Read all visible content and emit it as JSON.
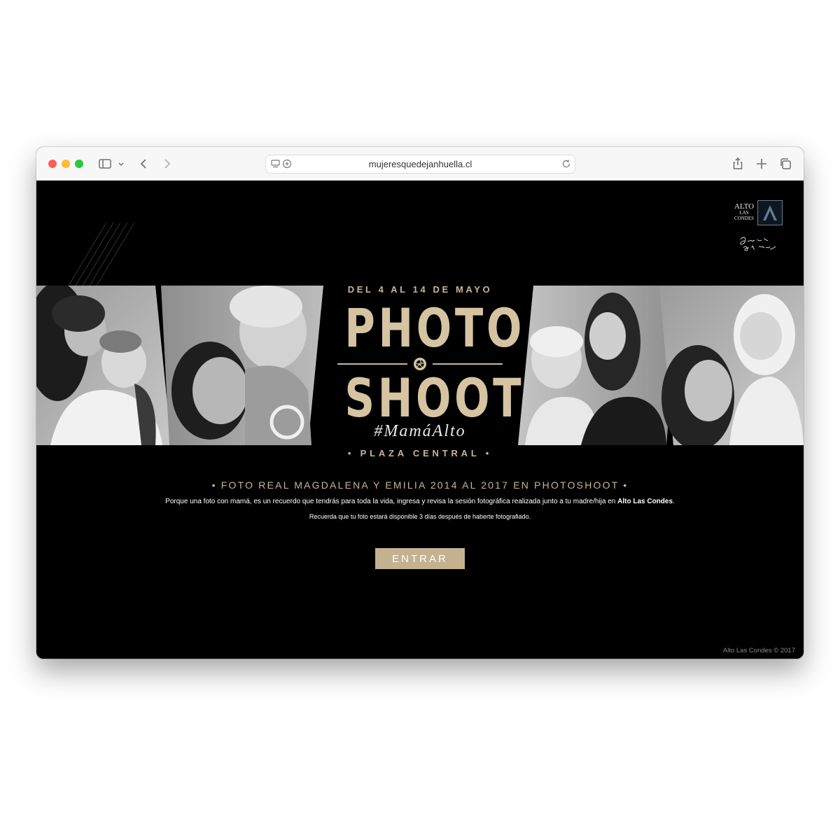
{
  "browser": {
    "url": "mujeresquedejanhuella.cl"
  },
  "brand": {
    "line1": "ALTO",
    "line2": "LAS",
    "line3": "CONDES",
    "tagline": "Cuanto más alto, mejor"
  },
  "hero": {
    "dates": "DEL 4 AL 14 DE MAYO",
    "title_top": "PHOTO",
    "title_bottom": "SHOOT",
    "hashtag": "#MamáAlto",
    "location": "• PLAZA CENTRAL •"
  },
  "content": {
    "headline": "• FOTO REAL MAGDALENA Y EMILIA 2014 AL 2017 EN PHOTOSHOOT •",
    "body_prefix": "Porque una foto con mamá, es un recuerdo que tendrás para toda la vida, ingresa y revisa la sesión fotográfica realizada junto a tu madre/hija en ",
    "body_bold": "Alto Las Condes",
    "body_suffix": ".",
    "note": "Recuerda que tu foto estará disponible 3 días después de haberte fotografiado.",
    "enter_label": "ENTRAR",
    "copyright": "Alto Las Condes © 2017"
  },
  "colors": {
    "accent": "#c9b595",
    "button": "#c3b190",
    "background": "#000000"
  }
}
